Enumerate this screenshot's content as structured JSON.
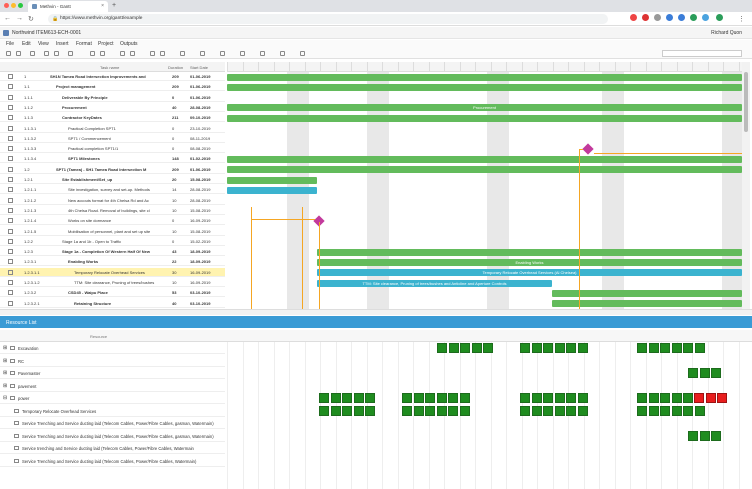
{
  "browser": {
    "tab_title": "Methvin - Gantt",
    "url": "https://www.methvin.org/gantt/example",
    "new_tab": "+",
    "tab_close": "×"
  },
  "app": {
    "title": "Northwind ITEM613-ECH-0001",
    "user": "Richard Quon"
  },
  "menu": [
    "File",
    "Edit",
    "View",
    "Insert",
    "Format",
    "Project",
    "Outputs"
  ],
  "grid": {
    "columns": {
      "task": "Task name",
      "duration": "Duration",
      "start": "Start Date"
    },
    "rows": [
      {
        "num": "1",
        "name": "SH1N Tamea Road Intersection Improvements and",
        "dur": "209",
        "start": "01-06-2019",
        "bold": true,
        "indent": 0
      },
      {
        "num": "1.1",
        "name": "Project management",
        "dur": "209",
        "start": "01-06-2019",
        "bold": true,
        "indent": 1
      },
      {
        "num": "1.1.1",
        "name": "Deliverable By Principle",
        "dur": "0",
        "start": "01-06-2019",
        "bold": true,
        "indent": 2
      },
      {
        "num": "1.1.2",
        "name": "Procurement",
        "dur": "40",
        "start": "28-08-2019",
        "bold": true,
        "indent": 2
      },
      {
        "num": "1.1.3",
        "name": "Contractor KeyDates",
        "dur": "211",
        "start": "09-10-2019",
        "bold": true,
        "indent": 2
      },
      {
        "num": "1.1.3.1",
        "name": "Practical Completion SPT1",
        "dur": "0",
        "start": "23-10-2019",
        "bold": false,
        "indent": 3
      },
      {
        "num": "1.1.3.2",
        "name": "SPT1 / Commencement",
        "dur": "0",
        "start": "08-11-2019",
        "bold": false,
        "indent": 3
      },
      {
        "num": "1.1.3.3",
        "name": "Practical completion SPT1/1",
        "dur": "0",
        "start": "08-08-2019",
        "bold": false,
        "indent": 3
      },
      {
        "num": "1.1.3.4",
        "name": "SPT1 Milestones",
        "dur": "148",
        "start": "01-02-2019",
        "bold": true,
        "indent": 3
      },
      {
        "num": "1.2",
        "name": "SPT1 (Tamea) - SH1 Tamea Road Intersection M",
        "dur": "209",
        "start": "01-06-2019",
        "bold": true,
        "indent": 1
      },
      {
        "num": "1.2.1",
        "name": "Site Establishment/Set_up",
        "dur": "20",
        "start": "15-08-2019",
        "bold": true,
        "indent": 2
      },
      {
        "num": "1.2.1.1",
        "name": "Site investigation, survey and set-up. Methods",
        "dur": "14",
        "start": "28-08-2019",
        "bold": false,
        "indent": 3
      },
      {
        "num": "1.2.1.2",
        "name": "New accouts format for 4th Chelsa Rd and Ac",
        "dur": "10",
        "start": "28-08-2019",
        "bold": false,
        "indent": 3
      },
      {
        "num": "1.2.1.3",
        "name": "4th Chelsa Road. Removal of buildings, site cl",
        "dur": "10",
        "start": "15-08-2019",
        "bold": false,
        "indent": 3
      },
      {
        "num": "1.2.1.4",
        "name": "Works on site dormance",
        "dur": "0",
        "start": "16-09-2019",
        "bold": false,
        "indent": 3
      },
      {
        "num": "1.2.1.5",
        "name": "Mobilisation of personnel, plant and set up site",
        "dur": "10",
        "start": "15-08-2019",
        "bold": false,
        "indent": 3
      },
      {
        "num": "1.2.2",
        "name": "Stage 1a and 1b - Open to Traffic",
        "dur": "0",
        "start": "15-02-2019",
        "bold": false,
        "indent": 2
      },
      {
        "num": "1.2.3",
        "name": "Stage 1a - Completion Of Western Half Of New",
        "dur": "43",
        "start": "18-09-2019",
        "bold": true,
        "indent": 2
      },
      {
        "num": "1.2.3.1",
        "name": "Enabling Works",
        "dur": "22",
        "start": "18-09-2019",
        "bold": true,
        "indent": 3
      },
      {
        "num": "1.2.3.1.1",
        "name": "Temporary Relocate Overhead Services",
        "dur": "30",
        "start": "16-09-2019",
        "bold": false,
        "indent": 4,
        "highlight": true
      },
      {
        "num": "1.2.3.1.2",
        "name": "TTM: Site clearance, Pruning of trees/bushes",
        "dur": "10",
        "start": "16-09-2019",
        "bold": false,
        "indent": 4
      },
      {
        "num": "1.2.3.2",
        "name": "CSD45 - Waipu Place",
        "dur": "53",
        "start": "03-10-2019",
        "bold": true,
        "indent": 3
      },
      {
        "num": "1.2.3.2.1",
        "name": "Retaining Structure",
        "dur": "40",
        "start": "03-10-2019",
        "bold": true,
        "indent": 4
      }
    ]
  },
  "chart": {
    "bar_labels": {
      "procurement": "Procurement",
      "enabling": "Enabling Works",
      "relocate": "Temporary Relocate Overhead Services (Al Chelsea)",
      "ttm": "TTM: Site clearance, Pruning of trees/bushes and Anticline and Aperture Controls"
    }
  },
  "resource": {
    "title": "Resource List",
    "col_header": "Resource",
    "rows": [
      {
        "label": "Excavation",
        "kind": "folder"
      },
      {
        "label": "RC",
        "kind": "folder"
      },
      {
        "label": "Pavemaster",
        "kind": "folder"
      },
      {
        "label": "pavement",
        "kind": "folder"
      },
      {
        "label": "power",
        "kind": "folder-open"
      },
      {
        "label": "Temporary Relocate Overhead Services",
        "kind": "task"
      },
      {
        "label": "Service Trenching and Service ducting laid (Telecom Cables, Power/Fibre Cables, gasman, Watermain)",
        "kind": "task"
      },
      {
        "label": "Service Trenching and Service ducting laid (Telecom Cables, Power/Fibre Cables, gasman, Watermain)",
        "kind": "task"
      },
      {
        "label": "Service trenching and Service ducting laid (Telecom Cables, Power/Fibre Cables, Watermain",
        "kind": "task"
      },
      {
        "label": "Service Trenching and Service ducting laid (Telecom Cables, Power/Fibre Cables, Watermain)",
        "kind": "task"
      }
    ]
  },
  "colors": {
    "bar_green": "#63bb5c",
    "bar_teal": "#3bb3cf",
    "milestone": "#c23a9c",
    "dependency": "#f5a623",
    "resource_green": "#1f8c1f",
    "resource_red": "#e81e1e",
    "resource_header": "#3a9bd5"
  }
}
